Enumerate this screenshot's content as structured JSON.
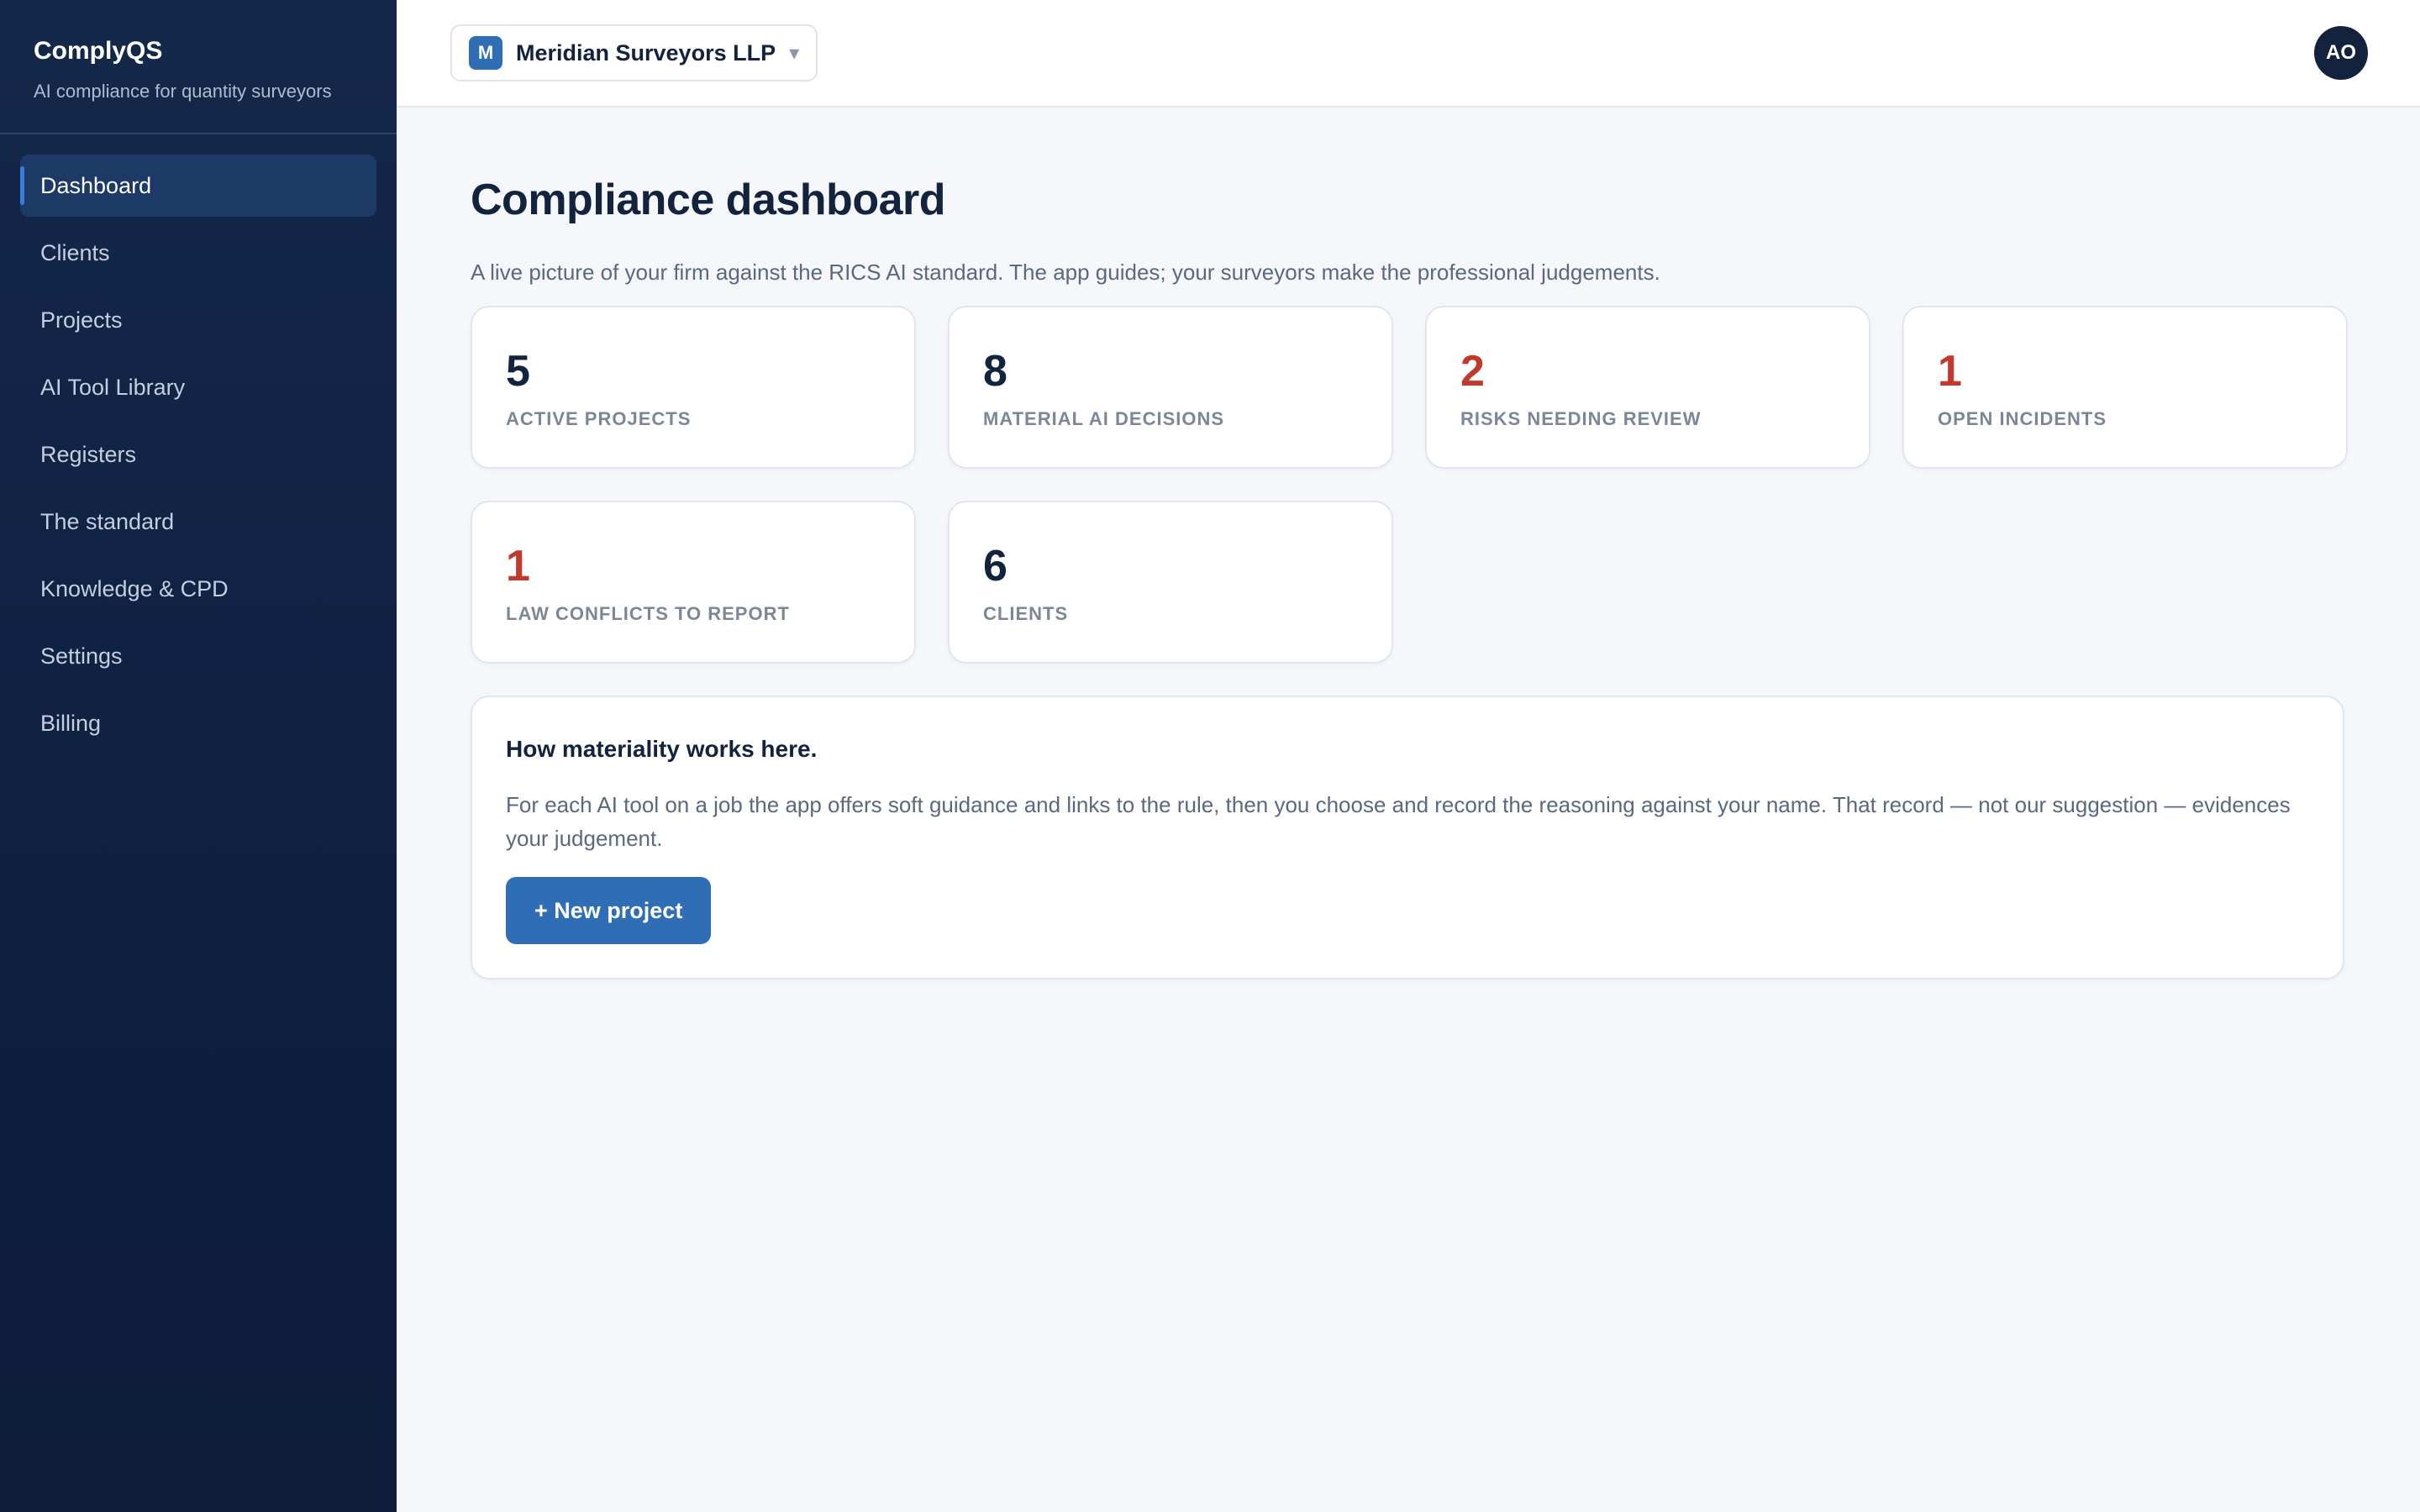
{
  "brand": {
    "name": "ComplyQS",
    "tagline": "AI compliance for quantity surveyors"
  },
  "sidebar": {
    "items": [
      {
        "label": "Dashboard",
        "active": true
      },
      {
        "label": "Clients"
      },
      {
        "label": "Projects"
      },
      {
        "label": "AI Tool Library"
      },
      {
        "label": "Registers"
      },
      {
        "label": "The standard"
      },
      {
        "label": "Knowledge & CPD"
      },
      {
        "label": "Settings"
      },
      {
        "label": "Billing"
      }
    ]
  },
  "topbar": {
    "org_initial": "M",
    "org_name": "Meridian Surveyors LLP",
    "caret": "▾",
    "user_initials": "AO"
  },
  "page": {
    "title": "Compliance dashboard",
    "subtitle": "A live picture of your firm against the RICS AI standard. The app guides; your surveyors make the professional judgements."
  },
  "stats": [
    {
      "value": "5",
      "label": "ACTIVE PROJECTS",
      "alert": false
    },
    {
      "value": "8",
      "label": "MATERIAL AI DECISIONS",
      "alert": false
    },
    {
      "value": "2",
      "label": "RISKS NEEDING REVIEW",
      "alert": true
    },
    {
      "value": "1",
      "label": "OPEN INCIDENTS",
      "alert": true
    },
    {
      "value": "1",
      "label": "LAW CONFLICTS TO REPORT",
      "alert": true
    },
    {
      "value": "6",
      "label": "CLIENTS",
      "alert": false
    }
  ],
  "info": {
    "title": "How materiality works here.",
    "body": "For each AI tool on a job the app offers soft guidance and links to the rule, then you choose and record the reasoning against your name. That record — not our suggestion — evidences your judgement.",
    "button_label": "+ New project"
  },
  "colors": {
    "sidebar_bg": "#0f2040",
    "accent": "#2f6db5",
    "alert": "#c0392b",
    "text_primary": "#13233d"
  }
}
